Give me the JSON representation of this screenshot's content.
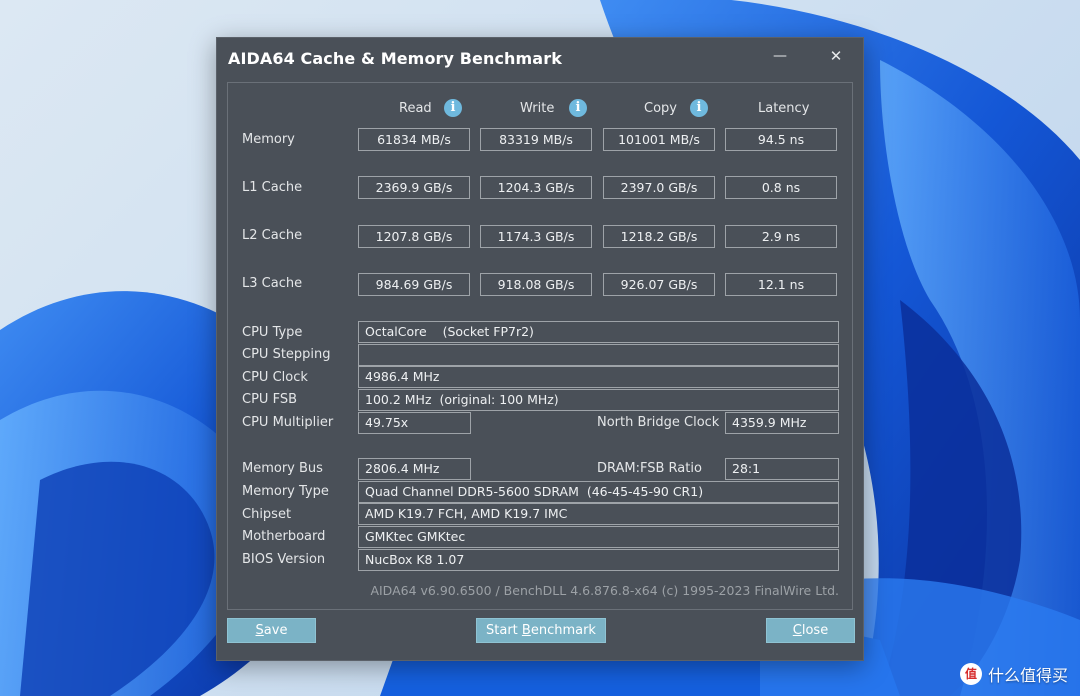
{
  "window": {
    "title": "AIDA64 Cache & Memory Benchmark",
    "minimize_glyph": "—",
    "close_glyph": "✕"
  },
  "columns": [
    {
      "label": "Read",
      "info_icon": true
    },
    {
      "label": "Write",
      "info_icon": true
    },
    {
      "label": "Copy",
      "info_icon": true
    },
    {
      "label": "Latency",
      "info_icon": false
    }
  ],
  "info_glyph": "i",
  "bench_rows": [
    {
      "label": "Memory",
      "read": "61834 MB/s",
      "write": "83319 MB/s",
      "copy": "101001 MB/s",
      "latency": "94.5 ns"
    },
    {
      "label": "L1 Cache",
      "read": "2369.9 GB/s",
      "write": "1204.3 GB/s",
      "copy": "2397.0 GB/s",
      "latency": "0.8 ns"
    },
    {
      "label": "L2 Cache",
      "read": "1207.8 GB/s",
      "write": "1174.3 GB/s",
      "copy": "1218.2 GB/s",
      "latency": "2.9 ns"
    },
    {
      "label": "L3 Cache",
      "read": "984.69 GB/s",
      "write": "918.08 GB/s",
      "copy": "926.07 GB/s",
      "latency": "12.1 ns"
    }
  ],
  "cpu": {
    "type_label": "CPU Type",
    "type_value": "OctalCore    (Socket FP7r2)",
    "stepping_label": "CPU Stepping",
    "stepping_value": "",
    "clock_label": "CPU Clock",
    "clock_value": "4986.4 MHz",
    "fsb_label": "CPU FSB",
    "fsb_value": "100.2 MHz  (original: 100 MHz)",
    "multiplier_label": "CPU Multiplier",
    "multiplier_value": "49.75x",
    "nb_clock_label": "North Bridge Clock",
    "nb_clock_value": "4359.9 MHz"
  },
  "memory": {
    "bus_label": "Memory Bus",
    "bus_value": "2806.4 MHz",
    "ratio_label": "DRAM:FSB Ratio",
    "ratio_value": "28:1",
    "type_label": "Memory Type",
    "type_value": "Quad Channel DDR5-5600 SDRAM  (46-45-45-90 CR1)",
    "chipset_label": "Chipset",
    "chipset_value": "AMD K19.7 FCH, AMD K19.7 IMC",
    "motherboard_label": "Motherboard",
    "motherboard_value": "GMKtec GMKtec",
    "bios_label": "BIOS Version",
    "bios_value": "NucBox K8 1.07"
  },
  "footer": "AIDA64 v6.90.6500 / BenchDLL 4.6.876.8-x64  (c) 1995-2023 FinalWire Ltd.",
  "buttons": {
    "save": {
      "accel": "S",
      "rest": "ave"
    },
    "start": {
      "pre": "Start ",
      "accel": "B",
      "rest": "enchmark"
    },
    "close": {
      "accel": "C",
      "rest": "lose"
    }
  },
  "watermark": {
    "logo_text": "值",
    "text": "什么值得买"
  },
  "colors": {
    "window_bg": "#4a5058",
    "button_bg": "#7bb3c6",
    "info_icon": "#6fb9de"
  }
}
